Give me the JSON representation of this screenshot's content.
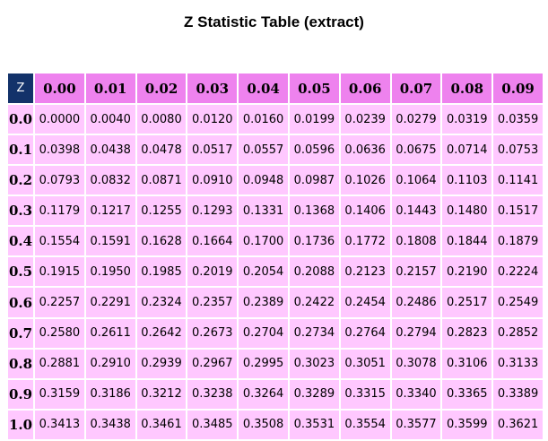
{
  "title": "Z Statistic Table (extract)",
  "table": {
    "corner": "Z",
    "columns": [
      "0.00",
      "0.01",
      "0.02",
      "0.03",
      "0.04",
      "0.05",
      "0.06",
      "0.07",
      "0.08",
      "0.09"
    ],
    "rows": [
      {
        "z": "0.0",
        "values": [
          "0.0000",
          "0.0040",
          "0.0080",
          "0.0120",
          "0.0160",
          "0.0199",
          "0.0239",
          "0.0279",
          "0.0319",
          "0.0359"
        ]
      },
      {
        "z": "0.1",
        "values": [
          "0.0398",
          "0.0438",
          "0.0478",
          "0.0517",
          "0.0557",
          "0.0596",
          "0.0636",
          "0.0675",
          "0.0714",
          "0.0753"
        ]
      },
      {
        "z": "0.2",
        "values": [
          "0.0793",
          "0.0832",
          "0.0871",
          "0.0910",
          "0.0948",
          "0.0987",
          "0.1026",
          "0.1064",
          "0.1103",
          "0.1141"
        ]
      },
      {
        "z": "0.3",
        "values": [
          "0.1179",
          "0.1217",
          "0.1255",
          "0.1293",
          "0.1331",
          "0.1368",
          "0.1406",
          "0.1443",
          "0.1480",
          "0.1517"
        ]
      },
      {
        "z": "0.4",
        "values": [
          "0.1554",
          "0.1591",
          "0.1628",
          "0.1664",
          "0.1700",
          "0.1736",
          "0.1772",
          "0.1808",
          "0.1844",
          "0.1879"
        ]
      },
      {
        "z": "0.5",
        "values": [
          "0.1915",
          "0.1950",
          "0.1985",
          "0.2019",
          "0.2054",
          "0.2088",
          "0.2123",
          "0.2157",
          "0.2190",
          "0.2224"
        ]
      },
      {
        "z": "0.6",
        "values": [
          "0.2257",
          "0.2291",
          "0.2324",
          "0.2357",
          "0.2389",
          "0.2422",
          "0.2454",
          "0.2486",
          "0.2517",
          "0.2549"
        ]
      },
      {
        "z": "0.7",
        "values": [
          "0.2580",
          "0.2611",
          "0.2642",
          "0.2673",
          "0.2704",
          "0.2734",
          "0.2764",
          "0.2794",
          "0.2823",
          "0.2852"
        ]
      },
      {
        "z": "0.8",
        "values": [
          "0.2881",
          "0.2910",
          "0.2939",
          "0.2967",
          "0.2995",
          "0.3023",
          "0.3051",
          "0.3078",
          "0.3106",
          "0.3133"
        ]
      },
      {
        "z": "0.9",
        "values": [
          "0.3159",
          "0.3186",
          "0.3212",
          "0.3238",
          "0.3264",
          "0.3289",
          "0.3315",
          "0.3340",
          "0.3365",
          "0.3389"
        ]
      },
      {
        "z": "1.0",
        "values": [
          "0.3413",
          "0.3438",
          "0.3461",
          "0.3485",
          "0.3508",
          "0.3531",
          "0.3554",
          "0.3577",
          "0.3599",
          "0.3621"
        ]
      }
    ]
  },
  "colors": {
    "corner_bg": "#13326a",
    "header_bg": "#ee82ee",
    "cell_bg": "#ffc8ff",
    "grid_line": "#ffffff"
  }
}
